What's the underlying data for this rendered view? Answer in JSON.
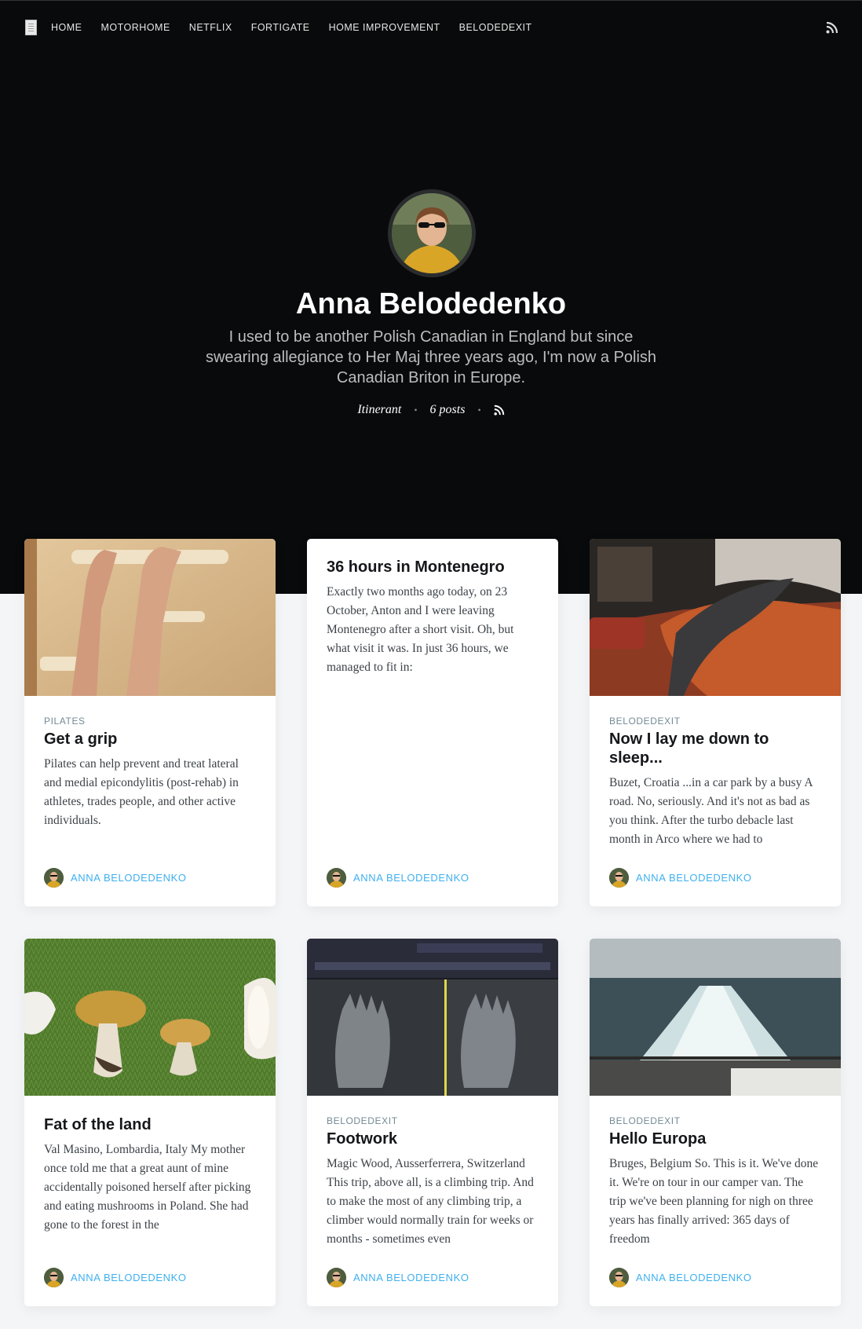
{
  "nav": {
    "items": [
      "HOME",
      "MOTORHOME",
      "NETFLIX",
      "FORTIGATE",
      "HOME IMPROVEMENT",
      "BELODEDEXIT"
    ]
  },
  "profile": {
    "name": "Anna Belodedenko",
    "bio": "I used to be another Polish Canadian in England but since swearing allegiance to Her Maj three years ago, I'm now a Polish Canadian Briton in Europe.",
    "location": "Itinerant",
    "post_count": "6 posts"
  },
  "posts": [
    {
      "tag": "PILATES",
      "title": "Get a grip",
      "excerpt": "Pilates can help prevent and treat lateral and medial epicondylitis (post-rehab) in athletes, trades people, and other active individuals.",
      "author": "ANNA BELODEDENKO",
      "image": "climbing-hangboard-arms"
    },
    {
      "tag": "",
      "title": "36 hours in Montenegro",
      "excerpt": "Exactly two months ago today, on 23 October, Anton and I were leaving Montenegro after a short visit. Oh, but what visit it was. In just 36 hours, we managed to fit in:",
      "author": "ANNA BELODEDENKO",
      "image": ""
    },
    {
      "tag": "BELODEDEXIT",
      "title": "Now I lay me down to sleep...",
      "excerpt": "Buzet, Croatia ...in a car park by a busy A road. No, seriously. And it's not as bad as you think. After the turbo debacle last month in Arco where we had to",
      "author": "ANNA BELODEDENKO",
      "image": "camper-bed"
    },
    {
      "tag": "",
      "title": "Fat of the land",
      "excerpt": "Val Masino, Lombardia, Italy My mother once told me that a great aunt of mine accidentally poisoned herself after picking and eating mushrooms in Poland. She had gone to the forest in the",
      "author": "ANNA BELODEDENKO",
      "image": "mushrooms-on-grass"
    },
    {
      "tag": "BELODEDEXIT",
      "title": "Footwork",
      "excerpt": "Magic Wood, Ausserferrera, Switzerland This trip, above all, is a climbing trip. And to make the most of any climbing trip, a climber would normally train for weeks or months - sometimes even",
      "author": "ANNA BELODEDENKO",
      "image": "foot-xray"
    },
    {
      "tag": "BELODEDEXIT",
      "title": "Hello Europa",
      "excerpt": "Bruges, Belgium So. This is it. We've done it. We're on tour in our camper van. The trip we've been planning for nigh on three years has finally arrived: 365 days of freedom",
      "author": "ANNA BELODEDENKO",
      "image": "ferry-wake"
    }
  ]
}
